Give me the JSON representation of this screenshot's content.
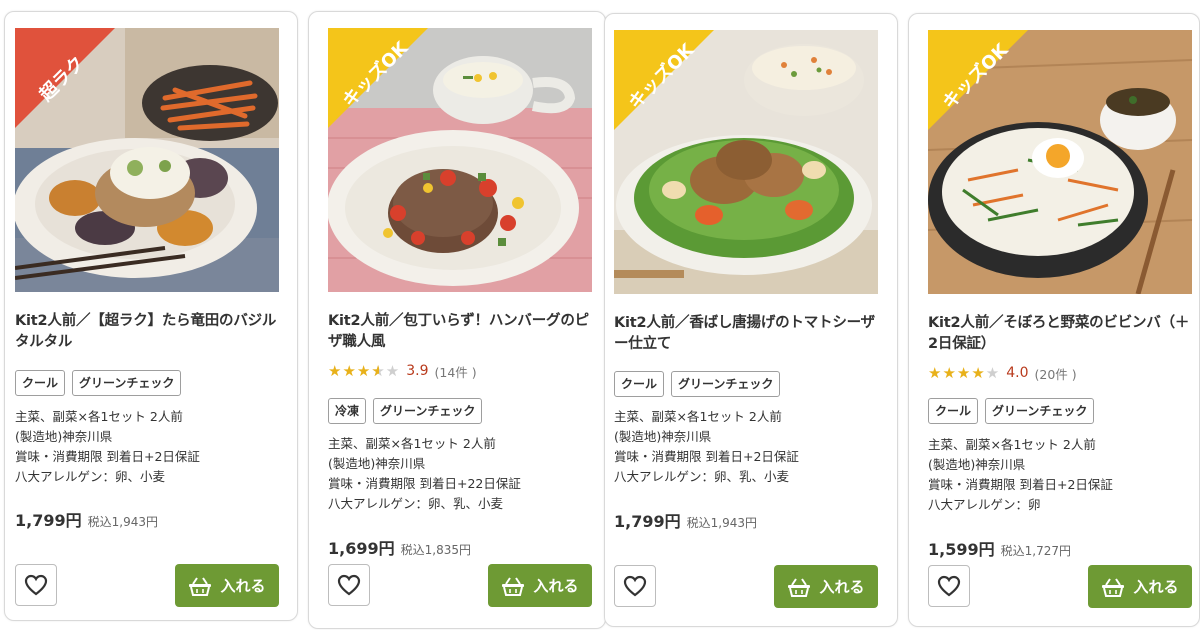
{
  "colors": {
    "cart_button": "#6e9a34",
    "ribbon_red": "#e0523c",
    "ribbon_yellow": "#f4c51a",
    "star": "#e8b11a",
    "rating_value": "#b83a1c"
  },
  "products": [
    {
      "ribbon": "超ラク",
      "ribbon_color": "red",
      "title": "Kit2人前／【超ラク】たら竜田のバジルタルタル",
      "rating": null,
      "tags": [
        "クール",
        "グリーンチェック"
      ],
      "desc": [
        "主菜、副菜×各1セット 2人前",
        "(製造地)神奈川県",
        "賞味・消費期限 到着日+2日保証",
        "八大アレルゲン：卵、小麦"
      ],
      "price": "1,799円",
      "tax_price": "税込1,943円",
      "cart_label": "入れる",
      "favorite_icon": "heart-icon",
      "cart_icon": "basket-icon"
    },
    {
      "ribbon": "キッズOK",
      "ribbon_color": "yellow",
      "title": "Kit2人前／包丁いらず！ハンバーグのピザ職人風",
      "rating": {
        "stars": 3.5,
        "avg": "3.9",
        "count": "(14件 )"
      },
      "tags": [
        "冷凍",
        "グリーンチェック"
      ],
      "desc": [
        "主菜、副菜×各1セット 2人前",
        "(製造地)神奈川県",
        "賞味・消費期限 到着日+22日保証",
        "八大アレルゲン：卵、乳、小麦"
      ],
      "price": "1,699円",
      "tax_price": "税込1,835円",
      "cart_label": "入れる",
      "favorite_icon": "heart-icon",
      "cart_icon": "basket-icon"
    },
    {
      "ribbon": "キッズOK",
      "ribbon_color": "yellow",
      "title": "Kit2人前／香ばし唐揚げのトマトシーザー仕立て",
      "rating": null,
      "tags": [
        "クール",
        "グリーンチェック"
      ],
      "desc": [
        "主菜、副菜×各1セット 2人前",
        "(製造地)神奈川県",
        "賞味・消費期限 到着日+2日保証",
        "八大アレルゲン：卵、乳、小麦"
      ],
      "price": "1,799円",
      "tax_price": "税込1,943円",
      "cart_label": "入れる",
      "favorite_icon": "heart-icon",
      "cart_icon": "basket-icon"
    },
    {
      "ribbon": "キッズOK",
      "ribbon_color": "yellow",
      "title": "Kit2人前／そぼろと野菜のビビンバ（＋2日保証）",
      "rating": {
        "stars": 4,
        "avg": "4.0",
        "count": "(20件 )"
      },
      "tags": [
        "クール",
        "グリーンチェック"
      ],
      "desc": [
        "主菜、副菜×各1セット 2人前",
        "(製造地)神奈川県",
        "賞味・消費期限 到着日+2日保証",
        "八大アレルゲン：卵"
      ],
      "price": "1,599円",
      "tax_price": "税込1,727円",
      "cart_label": "入れる",
      "favorite_icon": "heart-icon",
      "cart_icon": "basket-icon"
    }
  ]
}
